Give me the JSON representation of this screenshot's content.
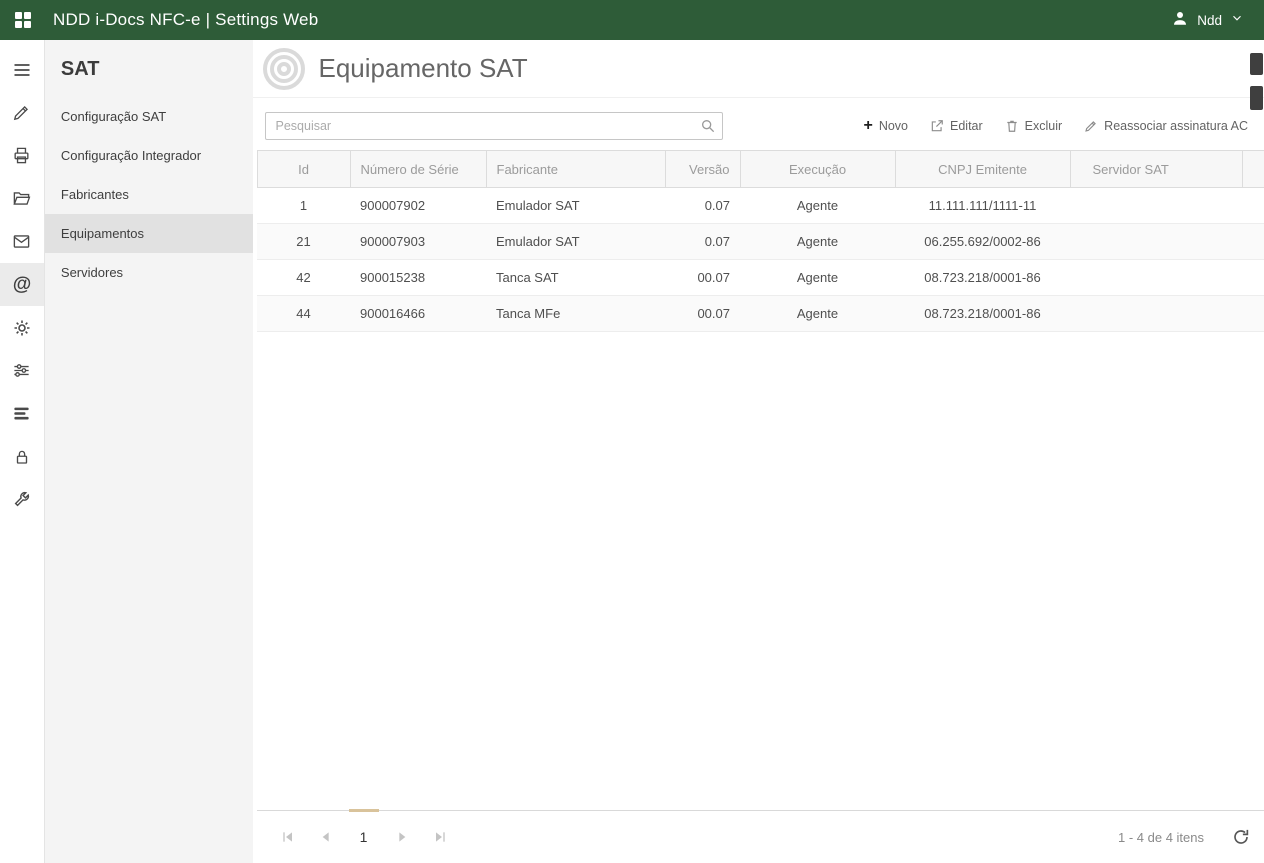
{
  "colors": {
    "topbar": "#2e5c38",
    "accent": "#d9c39b"
  },
  "topbar": {
    "title": "NDD i-Docs NFC-e | Settings Web",
    "user": "Ndd"
  },
  "rail": {
    "items": [
      {
        "icon": "menu-icon"
      },
      {
        "icon": "brush-icon"
      },
      {
        "icon": "printer-icon"
      },
      {
        "icon": "folder-icon"
      },
      {
        "icon": "mail-icon"
      },
      {
        "icon": "at-icon",
        "active": true
      },
      {
        "icon": "gear-icon"
      },
      {
        "icon": "sliders-icon"
      },
      {
        "icon": "stack-icon"
      },
      {
        "icon": "lock-icon"
      },
      {
        "icon": "wrench-icon"
      }
    ]
  },
  "sidebar": {
    "title": "SAT",
    "items": [
      {
        "label": "Configuração SAT",
        "active": false
      },
      {
        "label": "Configuração Integrador",
        "active": false
      },
      {
        "label": "Fabricantes",
        "active": false
      },
      {
        "label": "Equipamentos",
        "active": true
      },
      {
        "label": "Servidores",
        "active": false
      }
    ]
  },
  "page": {
    "title": "Equipamento SAT"
  },
  "toolbar": {
    "search_placeholder": "Pesquisar",
    "buttons": [
      {
        "label": "Novo",
        "icon": "plus-icon"
      },
      {
        "label": "Editar",
        "icon": "edit-icon"
      },
      {
        "label": "Excluir",
        "icon": "trash-icon"
      },
      {
        "label": "Reassociar assinatura AC",
        "icon": "pencil-icon"
      }
    ]
  },
  "table": {
    "columns": [
      "Id",
      "Número de Série",
      "Fabricante",
      "Versão",
      "Execução",
      "CNPJ Emitente",
      "Servidor SAT"
    ],
    "rows": [
      [
        "1",
        "900007902",
        "Emulador SAT",
        "0.07",
        "Agente",
        "11.111.111/1111-11",
        ""
      ],
      [
        "21",
        "900007903",
        "Emulador SAT",
        "0.07",
        "Agente",
        "06.255.692/0002-86",
        ""
      ],
      [
        "42",
        "900015238",
        "Tanca SAT",
        "00.07",
        "Agente",
        "08.723.218/0001-86",
        ""
      ],
      [
        "44",
        "900016466",
        "Tanca MFe",
        "00.07",
        "Agente",
        "08.723.218/0001-86",
        ""
      ]
    ]
  },
  "pager": {
    "page": "1",
    "info": "1 - 4 de 4 itens"
  }
}
